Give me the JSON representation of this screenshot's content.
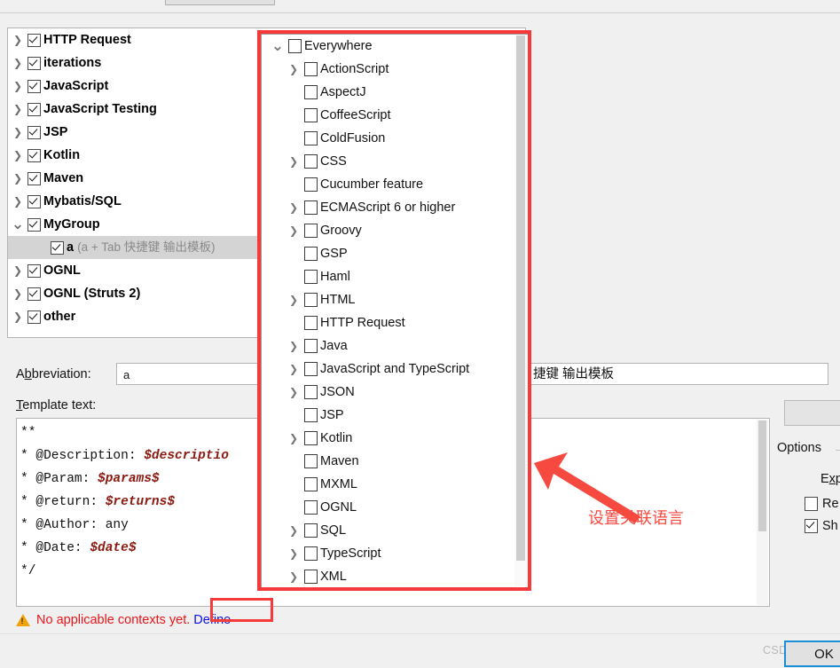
{
  "dialog": {
    "tree_panel_name": "Live templates tree",
    "groups": [
      {
        "label": "HTTP Request",
        "expandable": true,
        "expanded": false,
        "checked": true
      },
      {
        "label": "iterations",
        "expandable": true,
        "expanded": false,
        "checked": true
      },
      {
        "label": "JavaScript",
        "expandable": true,
        "expanded": false,
        "checked": true
      },
      {
        "label": "JavaScript Testing",
        "expandable": true,
        "expanded": false,
        "checked": true
      },
      {
        "label": "JSP",
        "expandable": true,
        "expanded": false,
        "checked": true
      },
      {
        "label": "Kotlin",
        "expandable": true,
        "expanded": false,
        "checked": true
      },
      {
        "label": "Maven",
        "expandable": true,
        "expanded": false,
        "checked": true
      },
      {
        "label": "Mybatis/SQL",
        "expandable": true,
        "expanded": false,
        "checked": true
      },
      {
        "label": "MyGroup",
        "expandable": true,
        "expanded": true,
        "checked": true
      },
      {
        "label": "a",
        "hint": "(a + Tab 快捷键 输出模板)",
        "child": true,
        "selected": true,
        "checked": true
      },
      {
        "label": "OGNL",
        "expandable": true,
        "expanded": false,
        "checked": true
      },
      {
        "label": "OGNL (Struts 2)",
        "expandable": true,
        "expanded": false,
        "checked": true
      },
      {
        "label": "other",
        "expandable": true,
        "expanded": false,
        "checked": true
      }
    ],
    "abbreviation": {
      "label_prefix": "A",
      "label_underlined": "b",
      "label_suffix": "breviation:",
      "value": "a"
    },
    "description": {
      "label": "Description:",
      "value": "捷键 输出模板"
    },
    "template_text": {
      "label_prefix": "",
      "label_underlined": "T",
      "label_suffix": "emplate text:",
      "lines": [
        {
          "plain": "**",
          "var": ""
        },
        {
          "plain": "* @Description: ",
          "var": "$descriptio"
        },
        {
          "plain": "* @Param: ",
          "var": "$params$"
        },
        {
          "plain": "* @return: ",
          "var": "$returns$"
        },
        {
          "plain": "* @Author: any",
          "var": ""
        },
        {
          "plain": "* @Date: ",
          "var": "$date$"
        },
        {
          "plain": "*/",
          "var": ""
        }
      ]
    },
    "warning": {
      "message": "No applicable contexts yet.",
      "link": "Define"
    },
    "options": {
      "title": "Options",
      "expand_label_prefix": "E",
      "expand_label_underlined": "x",
      "expand_label_suffix": "pand",
      "checkboxes": [
        {
          "label": "Re",
          "checked": false
        },
        {
          "label": "Sh",
          "checked": true
        }
      ]
    },
    "ok_button": "OK",
    "watermark": "CSDN @%%%%"
  },
  "context_popup": {
    "name": "context language chooser",
    "items": [
      {
        "label": "Everywhere",
        "level": 0,
        "arrow": "down",
        "checked": false
      },
      {
        "label": "ActionScript",
        "level": 1,
        "arrow": "right",
        "checked": false
      },
      {
        "label": "AspectJ",
        "level": 1,
        "arrow": "none",
        "checked": false
      },
      {
        "label": "CoffeeScript",
        "level": 1,
        "arrow": "none",
        "checked": false
      },
      {
        "label": "ColdFusion",
        "level": 1,
        "arrow": "none",
        "checked": false
      },
      {
        "label": "CSS",
        "level": 1,
        "arrow": "right",
        "checked": false
      },
      {
        "label": "Cucumber feature",
        "level": 1,
        "arrow": "none",
        "checked": false
      },
      {
        "label": "ECMAScript 6 or higher",
        "level": 1,
        "arrow": "right",
        "checked": false
      },
      {
        "label": "Groovy",
        "level": 1,
        "arrow": "right",
        "checked": false
      },
      {
        "label": "GSP",
        "level": 1,
        "arrow": "none",
        "checked": false
      },
      {
        "label": "Haml",
        "level": 1,
        "arrow": "none",
        "checked": false
      },
      {
        "label": "HTML",
        "level": 1,
        "arrow": "right",
        "checked": false
      },
      {
        "label": "HTTP Request",
        "level": 1,
        "arrow": "none",
        "checked": false
      },
      {
        "label": "Java",
        "level": 1,
        "arrow": "right",
        "checked": false
      },
      {
        "label": "JavaScript and TypeScript",
        "level": 1,
        "arrow": "right",
        "checked": false
      },
      {
        "label": "JSON",
        "level": 1,
        "arrow": "right",
        "checked": false
      },
      {
        "label": "JSP",
        "level": 1,
        "arrow": "none",
        "checked": false
      },
      {
        "label": "Kotlin",
        "level": 1,
        "arrow": "right",
        "checked": false
      },
      {
        "label": "Maven",
        "level": 1,
        "arrow": "none",
        "checked": false
      },
      {
        "label": "MXML",
        "level": 1,
        "arrow": "none",
        "checked": false
      },
      {
        "label": "OGNL",
        "level": 1,
        "arrow": "none",
        "checked": false
      },
      {
        "label": "SQL",
        "level": 1,
        "arrow": "right",
        "checked": false
      },
      {
        "label": "TypeScript",
        "level": 1,
        "arrow": "right",
        "checked": false
      },
      {
        "label": "XML",
        "level": 1,
        "arrow": "right",
        "checked": false
      }
    ]
  },
  "annotations": {
    "arrow_label": "设置关联语言",
    "highlight_color": "#f63a3a"
  }
}
